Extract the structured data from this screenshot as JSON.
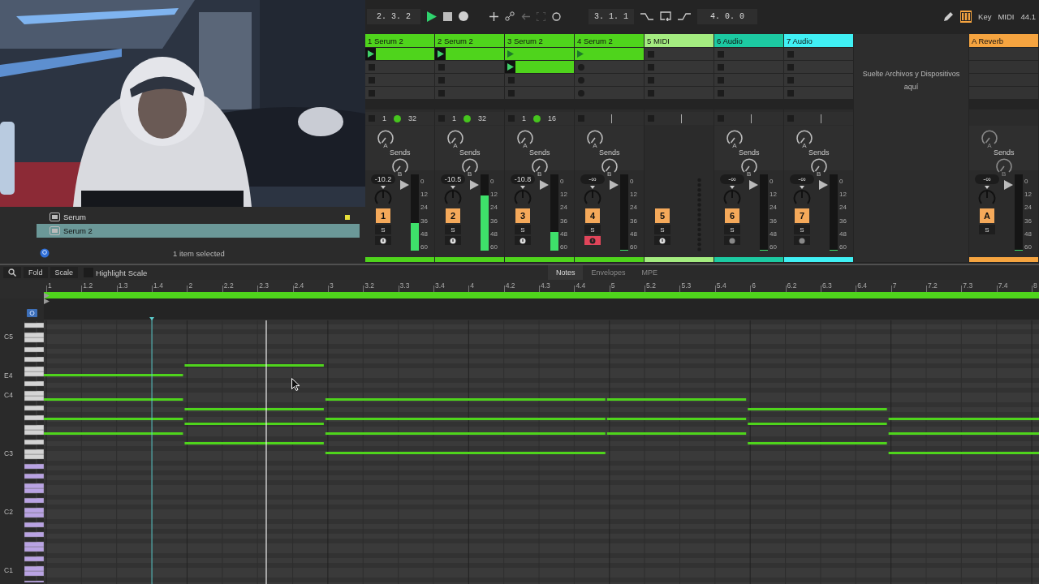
{
  "browser": {
    "items": [
      {
        "label": "Serum",
        "selected": false,
        "color": "#e8e03a"
      },
      {
        "label": "Serum 2",
        "selected": true
      }
    ],
    "status": "1 item selected"
  },
  "transport": {
    "position": "2. 3. 2",
    "playing": true,
    "recording": false,
    "loop_start": "3. 1. 1",
    "loop_length": "4. 0. 0",
    "midi_keyboard": true,
    "key_label": "Key",
    "midi_label": "MIDI",
    "sample_rate": "44.1"
  },
  "tracks": [
    {
      "name": "1 Serum 2",
      "color": "#4fd41c",
      "kind": "instrument",
      "slots": [
        {
          "kind": "playing"
        },
        {
          "kind": "stop"
        },
        {
          "kind": "stop"
        },
        {
          "kind": "stop"
        }
      ],
      "loop_start": "1",
      "loop_end": "32",
      "sends_label": "Sends",
      "send_a": "A",
      "send_b": "B",
      "volume": "-10.2",
      "number": "1",
      "solo": "S",
      "armed": false,
      "level": 0.36,
      "scale": [
        "0",
        "12",
        "24",
        "36",
        "48",
        "60"
      ]
    },
    {
      "name": "2 Serum 2",
      "color": "#4fd41c",
      "kind": "instrument",
      "slots": [
        {
          "kind": "playing"
        },
        {
          "kind": "stop"
        },
        {
          "kind": "stop"
        },
        {
          "kind": "stop"
        }
      ],
      "loop_start": "1",
      "loop_end": "32",
      "sends_label": "Sends",
      "send_a": "A",
      "send_b": "B",
      "volume": "-10.5",
      "number": "2",
      "solo": "S",
      "armed": false,
      "level": 0.72,
      "scale": [
        "0",
        "12",
        "24",
        "36",
        "48",
        "60"
      ]
    },
    {
      "name": "3 Serum 2",
      "color": "#4fd41c",
      "kind": "instrument",
      "slots": [
        {
          "kind": "clip"
        },
        {
          "kind": "playing"
        },
        {
          "kind": "stop"
        },
        {
          "kind": "stop"
        }
      ],
      "loop_start": "1",
      "loop_end": "16",
      "sends_label": "Sends",
      "send_a": "A",
      "send_b": "B",
      "volume": "-10.8",
      "number": "3",
      "solo": "S",
      "armed": false,
      "level": 0.24,
      "scale": [
        "0",
        "12",
        "24",
        "36",
        "48",
        "60"
      ]
    },
    {
      "name": "4 Serum 2",
      "color": "#4fd41c",
      "kind": "instrument",
      "slots": [
        {
          "kind": "clip"
        },
        {
          "kind": "record"
        },
        {
          "kind": "record"
        },
        {
          "kind": "record"
        }
      ],
      "sends_label": "Sends",
      "send_a": "A",
      "send_b": "B",
      "volume": "-∞",
      "number": "4",
      "solo": "S",
      "armed": true,
      "level": 0,
      "scale": [
        "0",
        "12",
        "24",
        "36",
        "48",
        "60"
      ]
    },
    {
      "name": "5 MIDI",
      "color": "#a4ec80",
      "kind": "midi",
      "slots": [
        {
          "kind": "stop"
        },
        {
          "kind": "stop"
        },
        {
          "kind": "stop"
        },
        {
          "kind": "stop"
        }
      ],
      "number": "5",
      "solo": "S",
      "armed": false
    },
    {
      "name": "6 Audio",
      "color": "#1ccaa2",
      "kind": "audio",
      "slots": [
        {
          "kind": "stop"
        },
        {
          "kind": "stop"
        },
        {
          "kind": "stop"
        },
        {
          "kind": "stop"
        }
      ],
      "sends_label": "Sends",
      "send_a": "A",
      "send_b": "B",
      "volume": "-∞",
      "number": "6",
      "solo": "S",
      "armed": false,
      "level": 0,
      "scale": [
        "0",
        "12",
        "24",
        "36",
        "48",
        "60"
      ]
    },
    {
      "name": "7 Audio",
      "color": "#40f0f4",
      "kind": "audio",
      "slots": [
        {
          "kind": "stop"
        },
        {
          "kind": "stop"
        },
        {
          "kind": "stop"
        },
        {
          "kind": "stop"
        }
      ],
      "sends_label": "Sends",
      "send_a": "A",
      "send_b": "B",
      "volume": "-∞",
      "number": "7",
      "solo": "S",
      "armed": false,
      "level": 0,
      "scale": [
        "0",
        "12",
        "24",
        "36",
        "48",
        "60"
      ]
    }
  ],
  "drop_zone": "Suelte Archivos y Dispositivos aquí",
  "return_track": {
    "name": "A Reverb",
    "color": "#f5a440",
    "kind": "return",
    "slots": [
      {
        "kind": "empty"
      },
      {
        "kind": "empty"
      },
      {
        "kind": "empty"
      },
      {
        "kind": "empty"
      }
    ],
    "sends_label": "Sends",
    "send_a": "A",
    "send_b": "B",
    "volume": "-∞",
    "number": "A",
    "solo": "S",
    "level": 0,
    "scale": [
      "0",
      "12",
      "24",
      "36",
      "48",
      "60"
    ]
  },
  "piano_roll": {
    "fold": "Fold",
    "scale": "Scale",
    "highlight_scale": {
      "label": "Highlight Scale",
      "checked": false
    },
    "tabs": [
      {
        "label": "Notes",
        "selected": true
      },
      {
        "label": "Envelopes",
        "selected": false
      },
      {
        "label": "MPE",
        "selected": false
      }
    ],
    "ruler": [
      "1",
      "1.2",
      "1.3",
      "1.4",
      "2",
      "2.2",
      "2.3",
      "2.4",
      "3",
      "3.2",
      "3.3",
      "3.4",
      "4",
      "4.2",
      "4.3",
      "4.4",
      "5",
      "5.2",
      "5.3",
      "5.4",
      "6",
      "6.2",
      "6.3",
      "6.4",
      "7",
      "7.2",
      "7.3",
      "7.4",
      "8"
    ],
    "key_labels": [
      "C5",
      "E4",
      "C4",
      "C3",
      "C2",
      "C1"
    ]
  }
}
